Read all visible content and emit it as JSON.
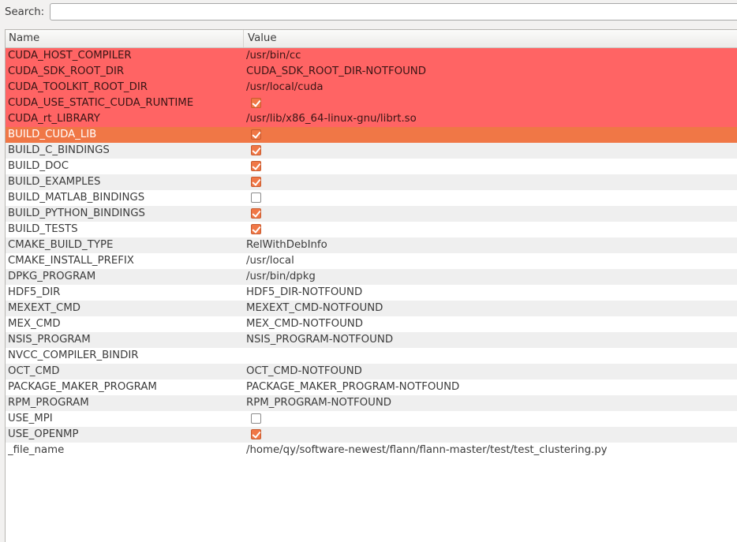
{
  "search": {
    "label": "Search:",
    "value": "",
    "placeholder": ""
  },
  "table": {
    "columns": [
      "Name",
      "Value"
    ],
    "rows": [
      {
        "name": "CUDA_HOST_COMPILER",
        "type": "text",
        "value": "/usr/bin/cc",
        "state": "changed"
      },
      {
        "name": "CUDA_SDK_ROOT_DIR",
        "type": "text",
        "value": "CUDA_SDK_ROOT_DIR-NOTFOUND",
        "state": "changed"
      },
      {
        "name": "CUDA_TOOLKIT_ROOT_DIR",
        "type": "text",
        "value": "/usr/local/cuda",
        "state": "changed"
      },
      {
        "name": "CUDA_USE_STATIC_CUDA_RUNTIME",
        "type": "bool",
        "checked": true,
        "state": "changed"
      },
      {
        "name": "CUDA_rt_LIBRARY",
        "type": "text",
        "value": "/usr/lib/x86_64-linux-gnu/librt.so",
        "state": "changed"
      },
      {
        "name": "BUILD_CUDA_LIB",
        "type": "bool",
        "checked": true,
        "state": "selected"
      },
      {
        "name": "BUILD_C_BINDINGS",
        "type": "bool",
        "checked": true,
        "state": "normal"
      },
      {
        "name": "BUILD_DOC",
        "type": "bool",
        "checked": true,
        "state": "normal"
      },
      {
        "name": "BUILD_EXAMPLES",
        "type": "bool",
        "checked": true,
        "state": "normal"
      },
      {
        "name": "BUILD_MATLAB_BINDINGS",
        "type": "bool",
        "checked": false,
        "state": "normal"
      },
      {
        "name": "BUILD_PYTHON_BINDINGS",
        "type": "bool",
        "checked": true,
        "state": "normal"
      },
      {
        "name": "BUILD_TESTS",
        "type": "bool",
        "checked": true,
        "state": "normal"
      },
      {
        "name": "CMAKE_BUILD_TYPE",
        "type": "text",
        "value": "RelWithDebInfo",
        "state": "normal"
      },
      {
        "name": "CMAKE_INSTALL_PREFIX",
        "type": "text",
        "value": "/usr/local",
        "state": "normal"
      },
      {
        "name": "DPKG_PROGRAM",
        "type": "text",
        "value": "/usr/bin/dpkg",
        "state": "normal"
      },
      {
        "name": "HDF5_DIR",
        "type": "text",
        "value": "HDF5_DIR-NOTFOUND",
        "state": "normal"
      },
      {
        "name": "MEXEXT_CMD",
        "type": "text",
        "value": "MEXEXT_CMD-NOTFOUND",
        "state": "normal"
      },
      {
        "name": "MEX_CMD",
        "type": "text",
        "value": "MEX_CMD-NOTFOUND",
        "state": "normal"
      },
      {
        "name": "NSIS_PROGRAM",
        "type": "text",
        "value": "NSIS_PROGRAM-NOTFOUND",
        "state": "normal"
      },
      {
        "name": "NVCC_COMPILER_BINDIR",
        "type": "text",
        "value": "",
        "state": "normal"
      },
      {
        "name": "OCT_CMD",
        "type": "text",
        "value": "OCT_CMD-NOTFOUND",
        "state": "normal"
      },
      {
        "name": "PACKAGE_MAKER_PROGRAM",
        "type": "text",
        "value": "PACKAGE_MAKER_PROGRAM-NOTFOUND",
        "state": "normal"
      },
      {
        "name": "RPM_PROGRAM",
        "type": "text",
        "value": "RPM_PROGRAM-NOTFOUND",
        "state": "normal"
      },
      {
        "name": "USE_MPI",
        "type": "bool",
        "checked": false,
        "state": "normal"
      },
      {
        "name": "USE_OPENMP",
        "type": "bool",
        "checked": true,
        "state": "normal"
      },
      {
        "name": "_file_name",
        "type": "text",
        "value": "/home/qy/software-newest/flann/flann-master/test/test_clustering.py",
        "state": "normal"
      }
    ]
  },
  "colors": {
    "changed_row": "#ff6464",
    "selected_row": "#f07746",
    "checkbox_checked": "#f07746",
    "alternate_row": "#efefef"
  }
}
